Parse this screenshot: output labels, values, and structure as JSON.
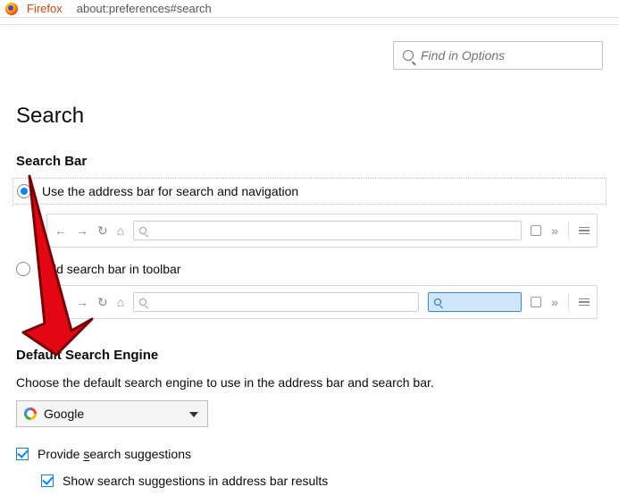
{
  "topbar": {
    "brand": "Firefox",
    "url": "about:preferences#search"
  },
  "find": {
    "placeholder": "Find in Options"
  },
  "page": {
    "title": "Search",
    "searchbar_heading": "Search Bar",
    "opt1": "Use the address bar for search and navigation",
    "opt2": "Add search bar in toolbar",
    "default_engine_heading": "Default Search Engine",
    "default_engine_desc": "Choose the default search engine to use in the address bar and search bar.",
    "engine_selected": "Google",
    "cb1_pre": "Provide ",
    "cb1_u": "s",
    "cb1_post": "earch suggestions",
    "cb2": "Show search suggestions in address bar results"
  }
}
